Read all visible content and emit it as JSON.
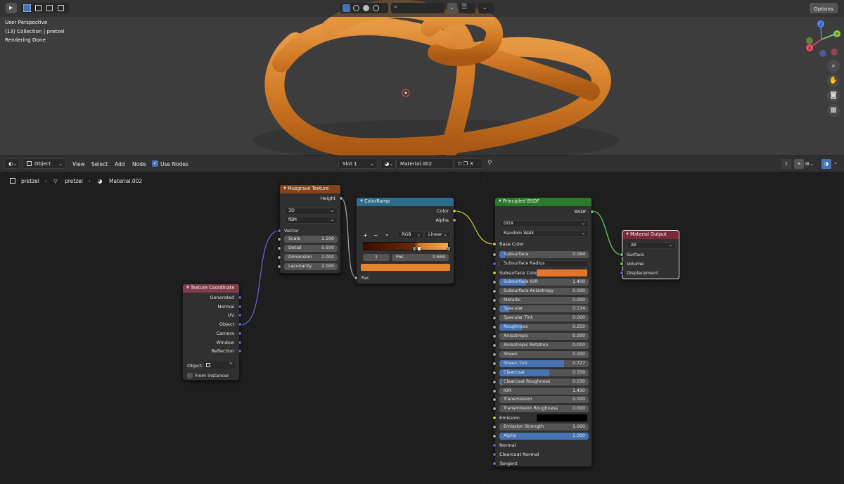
{
  "colors": {
    "viewport_bg": "#3d3d3d",
    "editor_bg": "#1e1e1e",
    "accent": "#4772b3",
    "pretzel": "#d6822c",
    "link_yellow": "#c7c729",
    "link_blue": "#6363c7",
    "link_green": "#63c763",
    "link_gray": "#a1a1a1"
  },
  "viewport": {
    "overlay": [
      "User Perspective",
      "(13) Collection | pretzel",
      "Rendering Done"
    ],
    "options_label": "Options",
    "gizmo": {
      "x": "X",
      "y": "Y",
      "z": "Z"
    },
    "nav_icons": [
      "zoom-icon",
      "hand-pan-icon",
      "camera-icon",
      "grid-icon"
    ]
  },
  "editor": {
    "header": {
      "mode": "Object",
      "menus": [
        "View",
        "Select",
        "Add",
        "Node"
      ],
      "use_nodes_label": "Use Nodes",
      "use_nodes_checked": true,
      "slot": "Slot 1",
      "material": "Material.002"
    },
    "breadcrumb": [
      "pretzel",
      "pretzel",
      "Material.002"
    ],
    "nodes": {
      "musgrave": {
        "title": "Musgrave Texture",
        "out_height": "Height",
        "dim": "3D",
        "type": "fBM",
        "in_vector": "Vector",
        "fields": [
          {
            "label": "Scale",
            "value": "1.500"
          },
          {
            "label": "Detail",
            "value": "5.500"
          },
          {
            "label": "Dimension",
            "value": "2.000"
          },
          {
            "label": "Lacunarity",
            "value": "2.000"
          }
        ]
      },
      "texcoord": {
        "title": "Texture Coordinate",
        "outputs": [
          "Generated",
          "Normal",
          "UV",
          "Object",
          "Camera",
          "Window",
          "Reflection"
        ],
        "object_label": "Object:",
        "from_instancer": "From Instancer"
      },
      "colorramp": {
        "title": "ColorRamp",
        "out_color": "Color",
        "out_alpha": "Alpha",
        "add": "+",
        "remove": "−",
        "menu": "⌄",
        "mode": "RGB",
        "interp": "Linear",
        "index": "1",
        "pos_label": "Pos",
        "pos_value": "0.659",
        "in_fac": "Fac",
        "swatch": "#e38431",
        "stops": [
          0.6,
          0.659,
          1.0
        ]
      },
      "bsdf": {
        "title": "Principled BSDF",
        "out": "BSDF",
        "distribution": "GGX",
        "sss_method": "Random Walk",
        "base_color": "Base Color",
        "fields": [
          {
            "label": "Subsurface",
            "value": "0.064",
            "fill": 0.064
          },
          {
            "label": "Subsurface Radius",
            "value": "",
            "dropdown": true
          },
          {
            "label": "Subsurface Color",
            "value": "",
            "color": "#e8742b"
          },
          {
            "label": "Subsurface IOR",
            "value": "1.400",
            "fill": 0.3
          },
          {
            "label": "Subsurface Anisotropy",
            "value": "0.000",
            "fill": 0
          },
          {
            "label": "Metallic",
            "value": "0.000",
            "fill": 0
          },
          {
            "label": "Specular",
            "value": "0.114",
            "fill": 0.114
          },
          {
            "label": "Specular Tint",
            "value": "0.000",
            "fill": 0
          },
          {
            "label": "Roughness",
            "value": "0.250",
            "fill": 0.25
          },
          {
            "label": "Anisotropic",
            "value": "0.000",
            "fill": 0
          },
          {
            "label": "Anisotropic Rotation",
            "value": "0.000",
            "fill": 0
          },
          {
            "label": "Sheen",
            "value": "0.000",
            "fill": 0
          },
          {
            "label": "Sheen Tint",
            "value": "0.727",
            "fill": 0.727
          },
          {
            "label": "Clearcoat",
            "value": "0.559",
            "fill": 0.559
          },
          {
            "label": "Clearcoat Roughness",
            "value": "0.030",
            "fill": 0.03
          },
          {
            "label": "IOR",
            "value": "1.450",
            "fill": 0
          },
          {
            "label": "Transmission",
            "value": "0.000",
            "fill": 0
          },
          {
            "label": "Transmission Roughness",
            "value": "0.000",
            "fill": 0
          },
          {
            "label": "Emission",
            "value": "",
            "color": "#000000"
          },
          {
            "label": "Emission Strength",
            "value": "1.000",
            "fill": 0
          },
          {
            "label": "Alpha",
            "value": "1.000",
            "fill": 1
          }
        ],
        "bottom": [
          "Normal",
          "Clearcoat Normal",
          "Tangent"
        ]
      },
      "output": {
        "title": "Material Output",
        "target": "All",
        "inputs": [
          "Surface",
          "Volume",
          "Displacement"
        ]
      }
    }
  }
}
